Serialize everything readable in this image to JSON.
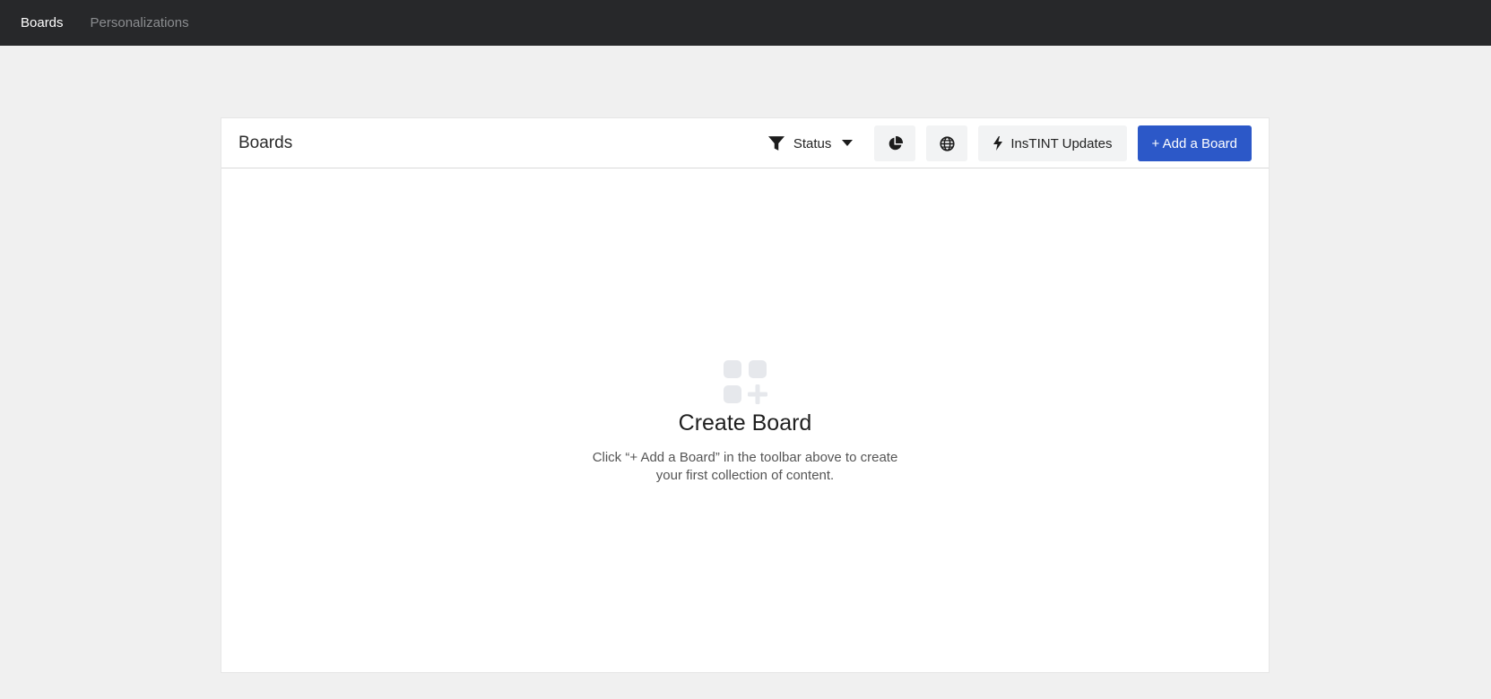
{
  "topnav": {
    "items": [
      {
        "label": "Boards",
        "active": true
      },
      {
        "label": "Personalizations",
        "active": false
      }
    ]
  },
  "toolbar": {
    "title": "Boards",
    "status_filter_label": "Status",
    "insights_icon": "pie-chart-icon",
    "globe_icon": "globe-icon",
    "updates_label": "InsTINT Updates",
    "add_board_label": "+ Add a Board"
  },
  "empty_state": {
    "icon": "grid-plus-icon",
    "heading": "Create Board",
    "description": "Click “+ Add a Board” in the toolbar above to create your first collection of content."
  },
  "colors": {
    "topnav_bg": "#27282a",
    "primary": "#2c58c8",
    "page_bg": "#f0f0f0"
  }
}
